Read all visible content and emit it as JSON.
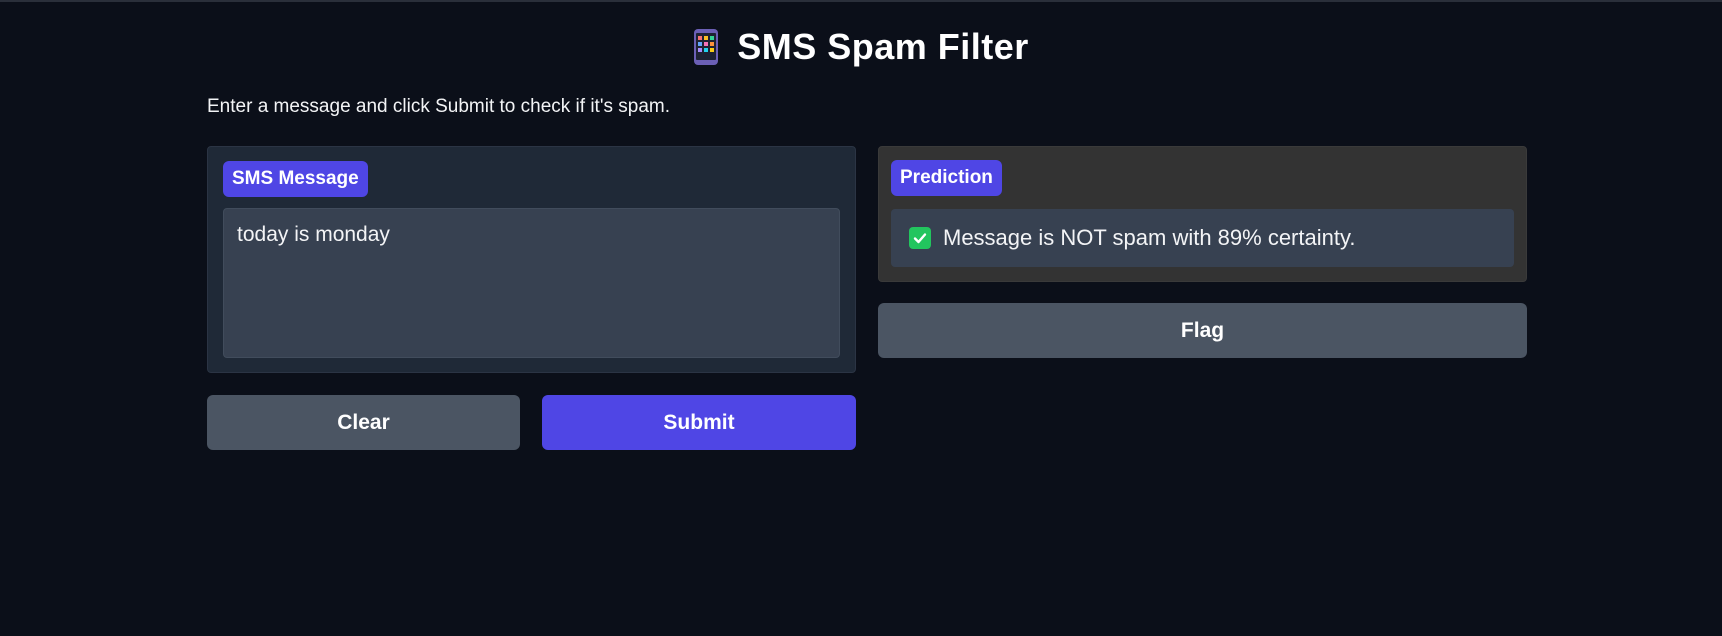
{
  "header": {
    "icon": "mobile-phone-icon",
    "title": "SMS Spam Filter"
  },
  "description": "Enter a message and click Submit to check if it's spam.",
  "input_panel": {
    "label": "SMS Message",
    "value": "today is monday"
  },
  "output_panel": {
    "label": "Prediction",
    "status_icon": "check-mark-icon",
    "result_text": "Message is NOT spam with 89% certainty."
  },
  "buttons": {
    "flag": "Flag",
    "clear": "Clear",
    "submit": "Submit"
  },
  "colors": {
    "background": "#0b0f19",
    "accent": "#4f46e5",
    "secondary_button": "#4b5563",
    "success": "#22c55e"
  }
}
